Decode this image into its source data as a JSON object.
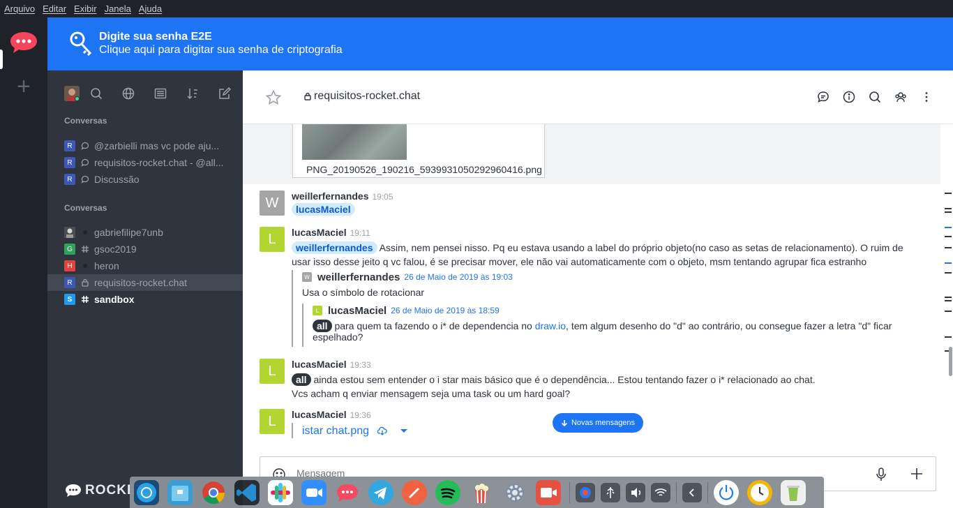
{
  "menubar": {
    "items": [
      "Arquivo",
      "Editar",
      "Exibir",
      "Janela",
      "Ajuda"
    ]
  },
  "e2e_banner": {
    "title": "Digite sua senha E2E",
    "subtitle": "Clique aqui para digitar sua senha de criptografia"
  },
  "sidebar": {
    "section1_title": "Conversas",
    "discussions": [
      {
        "avatar": "R",
        "label": "@zarbielli mas vc pode aju...",
        "icon": "discussion-icon"
      },
      {
        "avatar": "R",
        "label": "requisitos-rocket.chat - @all...",
        "icon": "discussion-icon"
      },
      {
        "avatar": "R",
        "label": "Discussão",
        "icon": "discussion-icon"
      }
    ],
    "section2_title": "Conversas",
    "rooms": [
      {
        "avatar": "",
        "label": "gabriefilipe7unb",
        "icon": "status-dot"
      },
      {
        "avatar": "G",
        "label": "gsoc2019",
        "icon": "hash-icon"
      },
      {
        "avatar": "H",
        "label": "heron",
        "icon": "status-dot"
      },
      {
        "avatar": "R",
        "label": "requisitos-rocket.chat",
        "icon": "lock-icon"
      },
      {
        "avatar": "S",
        "label": "sandbox",
        "icon": "hash-icon"
      }
    ],
    "brand": "ROCKET."
  },
  "room_header": {
    "title": "requisitos-rocket.chat"
  },
  "messages": {
    "attachment_name": "PNG_20190526_190216_5939931050292960416.png",
    "m1": {
      "avatar": "W",
      "user": "weillerfernandes",
      "time": "19:05",
      "mention": "lucasMaciel"
    },
    "m2": {
      "avatar": "L",
      "user": "lucasMaciel",
      "time": "19:11",
      "mention": "weillerfernandes",
      "text": "Assim, nem pensei nisso. Pq eu estava usando a label do próprio objeto(no caso as setas de relacionamento). O ruim de usar isso desse jeito q vc falou, é se precisar mover, ele não vai automaticamente com o objeto, msm tentando agrupar fica estranho",
      "quote": {
        "avatar": "W",
        "user": "weillerfernandes",
        "date": "26 de Maio de 2019 às 19:03",
        "text": "Usa o símbolo de rotacionar",
        "quote": {
          "avatar": "L",
          "user": "lucasMaciel",
          "date": "26 de Maio de 2019 às 18:59",
          "mention": "all",
          "text_before": "para quem ta fazendo o i* de dependencia no ",
          "link": "draw.io",
          "text_after": ", tem algum desenho do \"d\" ao contrário, ou consegue fazer a letra \"d\" ficar espelhado?"
        }
      }
    },
    "m3": {
      "avatar": "L",
      "user": "lucasMaciel",
      "time": "19:33",
      "mention": "all",
      "line1": "ainda estou sem entender o i star mais básico que é o dependência... Estou tentando fazer o i* relacionado ao chat.",
      "line2": "Vcs acham q enviar mensagem seja uma task ou um hard goal?"
    },
    "m4": {
      "avatar": "L",
      "user": "lucasMaciel",
      "time": "19:36",
      "file": "istar chat.png"
    },
    "new_messages_label": "Novas mensagens"
  },
  "composer": {
    "placeholder": "Mensagem"
  },
  "colors": {
    "accent": "#1d74f5",
    "sidebar_bg": "#2f343d",
    "avatar_l": "#b3d531",
    "avatar_w": "#a5a5a5",
    "avatar_r": "#3c57b8"
  }
}
